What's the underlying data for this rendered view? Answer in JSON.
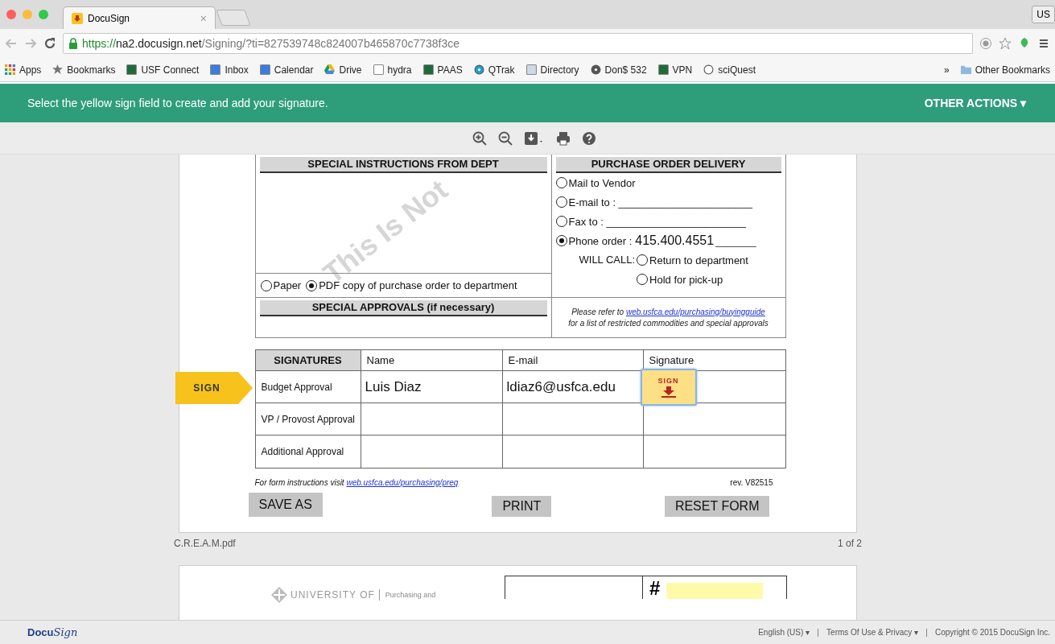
{
  "browser": {
    "tab": {
      "title": "DocuSign",
      "close": "×"
    },
    "profile": "US",
    "url": {
      "scheme": "https://",
      "host": "na2.docusign.net",
      "path": "/Signing/?ti=827539748c824007b465870c7738f3ce"
    },
    "bookmarks": [
      {
        "kind": "apps",
        "label": "Apps"
      },
      {
        "kind": "star",
        "label": "Bookmarks"
      },
      {
        "kind": "usf",
        "label": "USF Connect"
      },
      {
        "kind": "blue",
        "label": "Inbox"
      },
      {
        "kind": "blue",
        "label": "Calendar"
      },
      {
        "kind": "drive",
        "label": "Drive"
      },
      {
        "kind": "page",
        "label": "hydra"
      },
      {
        "kind": "usf",
        "label": "PAAS"
      },
      {
        "kind": "q",
        "label": "QTrak"
      },
      {
        "kind": "window",
        "label": "Directory"
      },
      {
        "kind": "disc",
        "label": "Don$ 532"
      },
      {
        "kind": "usf",
        "label": "VPN"
      },
      {
        "kind": "info",
        "label": "sciQuest"
      }
    ],
    "more": "»",
    "other_bookmarks": "Other Bookmarks"
  },
  "banner": {
    "message": "Select the yellow sign field to create and add your signature.",
    "other_actions": "OTHER ACTIONS ▾"
  },
  "document": {
    "watermark": "This Is Not",
    "instructions_heading": "SPECIAL INSTRUCTIONS FROM DEPT",
    "copy_options": [
      {
        "label": "Paper",
        "selected": false
      },
      {
        "label": "PDF copy of purchase order to department",
        "selected": true
      }
    ],
    "delivery_heading": "PURCHASE ORDER DELIVERY",
    "delivery_options": [
      {
        "label": "Mail to Vendor",
        "selected": false
      },
      {
        "label": "E-mail to : _______________________",
        "selected": false
      },
      {
        "label": "Fax to : ________________________",
        "selected": false
      },
      {
        "label": "Phone order :",
        "value": "415.400.4551",
        "blank": "_______",
        "selected": true
      }
    ],
    "will_call": {
      "label": "WILL CALL:",
      "options": [
        {
          "label": "Return to department",
          "selected": false
        },
        {
          "label": "Hold for pick-up",
          "selected": false
        }
      ]
    },
    "approvals_heading": "SPECIAL APPROVALS (if necessary)",
    "refer_note": {
      "prefix": "Please refer to",
      "link": "web.usfca.edu/purchasing/buyingguide",
      "line2": "for a list of restricted commodities and special approvals"
    },
    "signatures": {
      "columns": [
        "SIGNATURES",
        "Name",
        "E-mail",
        "Signature"
      ],
      "rows": [
        {
          "role": "Budget Approval",
          "name": "Luis Diaz",
          "email": "ldiaz6@usfca.edu",
          "sign_field": "SIGN"
        },
        {
          "role": "VP / Provost Approval"
        },
        {
          "role": "Additional Approval"
        }
      ]
    },
    "instructions_note": {
      "prefix": "For form instructions visit",
      "link": "web.usfca.edu/purchasing/preq"
    },
    "revision": "rev. V82515",
    "buttons": [
      "SAVE AS",
      "PRINT",
      "RESET FORM"
    ],
    "sign_tag": "SIGN",
    "filename": "C.R.E.A.M.pdf",
    "page_count": "1 of 2",
    "next_page": {
      "university": "UNIVERSITY OF",
      "department": "Purchasing and",
      "number_sign": "#"
    }
  },
  "footer": {
    "logo": [
      "Docu",
      "Sign"
    ],
    "links": [
      "English (US) ▾",
      "Terms Of Use & Privacy ▾"
    ],
    "copyright": "Copyright © 2015 DocuSign Inc."
  }
}
